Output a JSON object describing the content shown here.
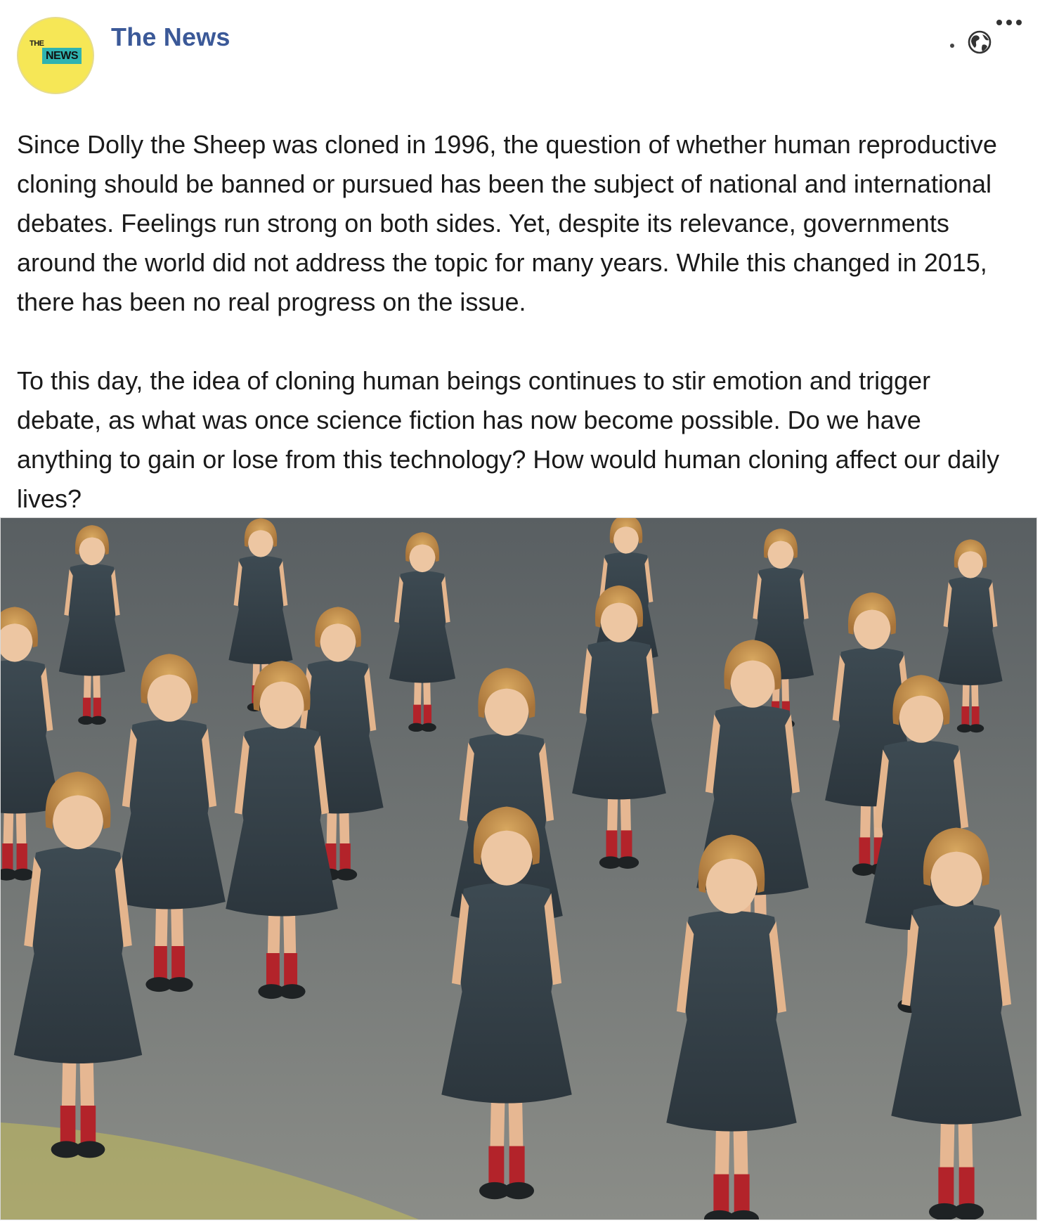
{
  "post": {
    "page_name": "The News",
    "avatar": {
      "line1": "THE",
      "line2": "NEWS",
      "bg_color": "#f6e756",
      "badge_color": "#2fb3b0"
    },
    "privacy_icon": "globe-icon",
    "more_icon": "more-horizontal-icon",
    "paragraphs": [
      "Since Dolly the Sheep was cloned in 1996, the question of whether human reproductive cloning should be banned or pursued has been the subject of national and international debates. Feelings run strong on both sides. Yet, despite its relevance, governments around the world did not address the topic for many years. While this changed in 2015, there has been no real progress on the issue.",
      "To this day, the idea of cloning human beings continues to stir emotion and trigger debate, as what was once science fiction has now become possible. Do we have anything to gain or lose from this technology? How would human cloning affect our daily lives?"
    ],
    "link_color": "#3b5998"
  }
}
